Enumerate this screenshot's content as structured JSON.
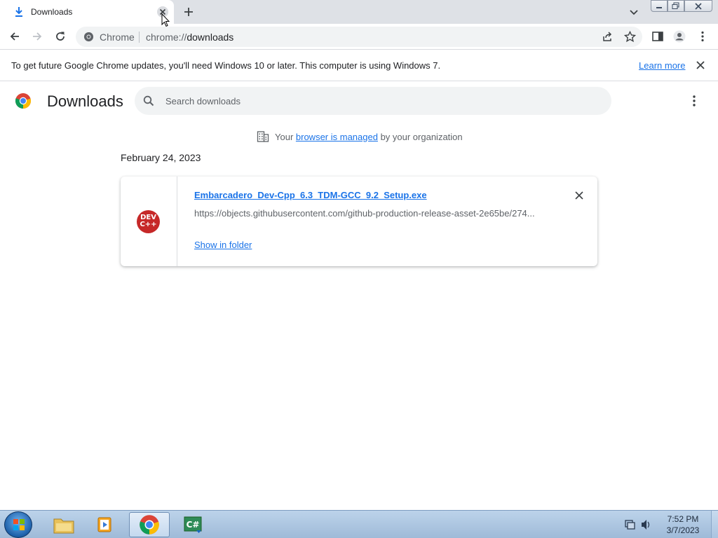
{
  "tab": {
    "title": "Downloads"
  },
  "toolbar": {
    "site_name": "Chrome",
    "url_scheme": "chrome://",
    "url_path": "downloads"
  },
  "infobar": {
    "message": "To get future Google Chrome updates, you'll need Windows 10 or later. This computer is using Windows 7.",
    "link": "Learn more"
  },
  "page": {
    "title": "Downloads",
    "search_placeholder": "Search downloads",
    "managed_prefix": "Your ",
    "managed_link": "browser is managed",
    "managed_suffix": " by your organization"
  },
  "downloads": [
    {
      "date": "February 24, 2023",
      "file_name": "Embarcadero_Dev-Cpp_6.3_TDM-GCC_9.2_Setup.exe",
      "url": "https://objects.githubusercontent.com/github-production-release-asset-2e65be/274...",
      "action": "Show in folder",
      "icon_text_line1": "DEV",
      "icon_text_line2": "C++",
      "icon_color": "#c62828"
    }
  ],
  "taskbar": {
    "time": "7:52 PM",
    "date": "3/7/2023",
    "apps": [
      "windows-explorer",
      "media-player",
      "chrome",
      "csharp-ide"
    ]
  },
  "colors": {
    "link": "#1a73e8",
    "tabstrip": "#dee1e6",
    "omnibox": "#f1f3f4"
  }
}
